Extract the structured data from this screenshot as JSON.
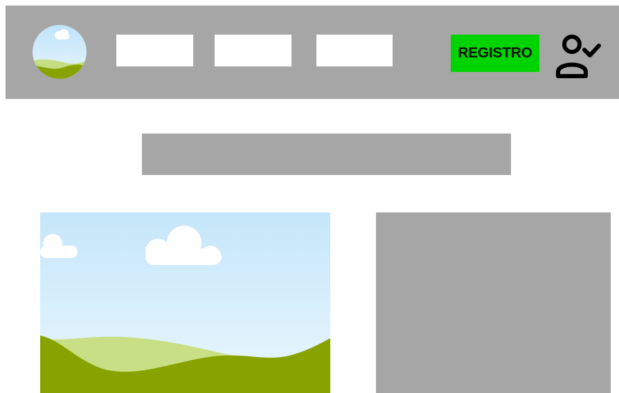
{
  "header": {
    "logo_icon": "landscape-icon",
    "nav_links": [
      "",
      "",
      ""
    ],
    "register_label": "REGISTRO",
    "register_color": "#00d400",
    "user_icon": "user-check-icon",
    "background_color": "#a6a6a6"
  },
  "main": {
    "title": "",
    "hero_image_icon": "landscape-image",
    "side_panel": ""
  }
}
